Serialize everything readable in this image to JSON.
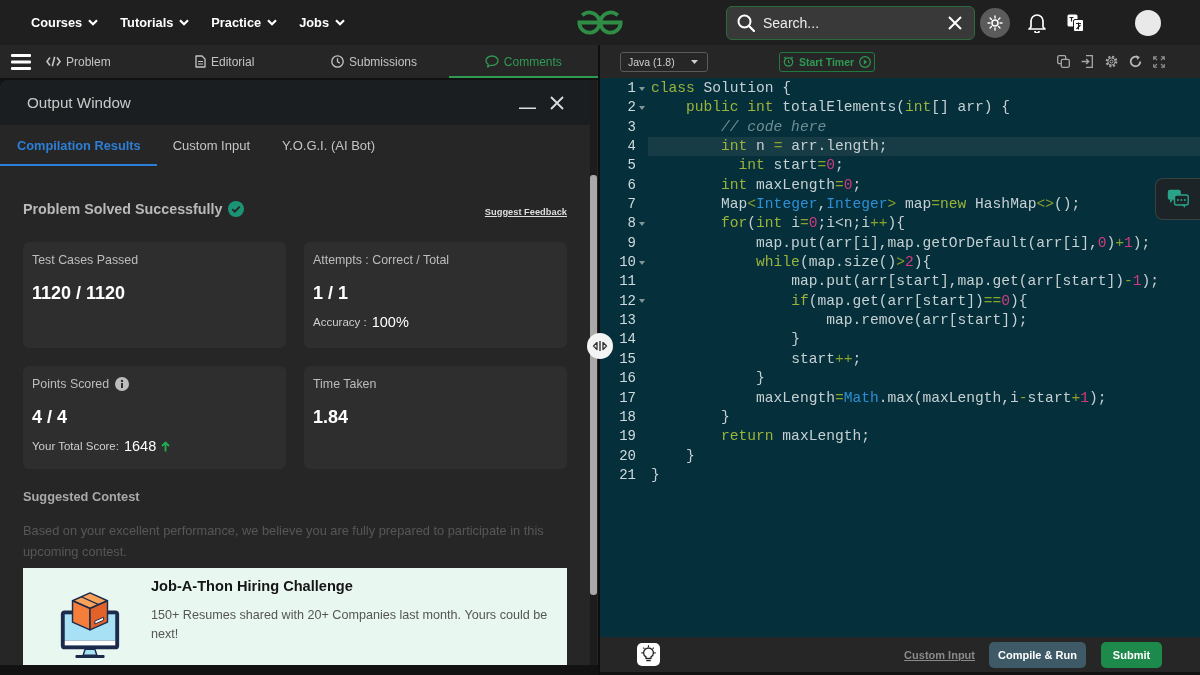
{
  "top_nav": {
    "menus": [
      {
        "label": "Courses"
      },
      {
        "label": "Tutorials"
      },
      {
        "label": "Practice"
      },
      {
        "label": "Jobs"
      }
    ],
    "search": {
      "placeholder": "Search..."
    }
  },
  "problem_tabs": [
    {
      "label": "Problem",
      "selected": false
    },
    {
      "label": "Editorial",
      "selected": false
    },
    {
      "label": "Submissions",
      "selected": false
    },
    {
      "label": "Comments",
      "selected": true
    }
  ],
  "output_window": {
    "title": "Output Window",
    "tabs": [
      {
        "label": "Compilation Results",
        "selected": true
      },
      {
        "label": "Custom Input",
        "selected": false
      },
      {
        "label": "Y.O.G.I. (AI Bot)",
        "selected": false
      }
    ],
    "result": {
      "heading": "Problem Solved Successfully",
      "solved": true,
      "feedback_link": "Suggest Feedback"
    },
    "stats": [
      {
        "label": "Test Cases Passed",
        "info": false,
        "value": "1120 / 1120"
      },
      {
        "label": "Attempts : Correct / Total",
        "info": false,
        "value": "1 / 1",
        "detail": {
          "label": "Accuracy :",
          "value": "100%",
          "rising": false
        }
      },
      {
        "label": "Points Scored",
        "info": true,
        "value": "4 / 4",
        "detail": {
          "label": "Your Total Score:",
          "value": "1648",
          "rising": true
        }
      },
      {
        "label": "Time Taken",
        "info": false,
        "value": "1.84"
      }
    ],
    "suggested_contest": {
      "heading": "Suggested Contest",
      "description": "Based on your excellent performance, we believe you are fully prepared to participate in this upcoming contest.",
      "card": {
        "title": "Job-A-Thon Hiring Challenge",
        "text": "150+ Resumes shared with 20+ Companies last month. Yours could be next!"
      }
    }
  },
  "editor": {
    "language": "Java (1.8)",
    "timer_button": "Start Timer",
    "lines": [
      {
        "number": "1",
        "foldable": true,
        "active": false,
        "tokens": [
          {
            "kind": "keyword",
            "text": "class"
          },
          {
            "kind": "plain",
            "text": " Solution {"
          }
        ]
      },
      {
        "number": "2",
        "foldable": true,
        "active": false,
        "tokens": [
          {
            "kind": "keyword",
            "text": "    public int"
          },
          {
            "kind": "plain",
            "text": " totalElements("
          },
          {
            "kind": "keyword",
            "text": "int"
          },
          {
            "kind": "plain",
            "text": "[] arr) {"
          }
        ]
      },
      {
        "number": "3",
        "foldable": false,
        "active": false,
        "tokens": [
          {
            "kind": "comment",
            "text": "        // code here"
          }
        ]
      },
      {
        "number": "4",
        "foldable": false,
        "active": true,
        "tokens": [
          {
            "kind": "keyword",
            "text": "        int"
          },
          {
            "kind": "plain",
            "text": " n "
          },
          {
            "kind": "operator",
            "text": "="
          },
          {
            "kind": "plain",
            "text": " arr.length;"
          }
        ]
      },
      {
        "number": "5",
        "foldable": false,
        "active": false,
        "tokens": [
          {
            "kind": "keyword",
            "text": "          int"
          },
          {
            "kind": "plain",
            "text": " start"
          },
          {
            "kind": "operator",
            "text": "="
          },
          {
            "kind": "number",
            "text": "0"
          },
          {
            "kind": "plain",
            "text": ";"
          }
        ]
      },
      {
        "number": "6",
        "foldable": false,
        "active": false,
        "tokens": [
          {
            "kind": "keyword",
            "text": "        int"
          },
          {
            "kind": "plain",
            "text": " maxLength"
          },
          {
            "kind": "operator",
            "text": "="
          },
          {
            "kind": "number",
            "text": "0"
          },
          {
            "kind": "plain",
            "text": ";"
          }
        ]
      },
      {
        "number": "7",
        "foldable": false,
        "active": false,
        "tokens": [
          {
            "kind": "plain",
            "text": "        Map"
          },
          {
            "kind": "operator",
            "text": "<"
          },
          {
            "kind": "type",
            "text": "Integer"
          },
          {
            "kind": "plain",
            "text": ","
          },
          {
            "kind": "type",
            "text": "Integer"
          },
          {
            "kind": "operator",
            "text": ">"
          },
          {
            "kind": "plain",
            "text": " map"
          },
          {
            "kind": "operator",
            "text": "="
          },
          {
            "kind": "keyword",
            "text": "new"
          },
          {
            "kind": "plain",
            "text": " HashMap"
          },
          {
            "kind": "operator",
            "text": "<>"
          },
          {
            "kind": "plain",
            "text": "();"
          }
        ]
      },
      {
        "number": "8",
        "foldable": true,
        "active": false,
        "tokens": [
          {
            "kind": "keyword",
            "text": "        for"
          },
          {
            "kind": "plain",
            "text": "("
          },
          {
            "kind": "keyword",
            "text": "int"
          },
          {
            "kind": "plain",
            "text": " i"
          },
          {
            "kind": "operator",
            "text": "="
          },
          {
            "kind": "number",
            "text": "0"
          },
          {
            "kind": "plain",
            "text": ";i<n;i"
          },
          {
            "kind": "operator",
            "text": "++"
          },
          {
            "kind": "plain",
            "text": "){"
          }
        ]
      },
      {
        "number": "9",
        "foldable": false,
        "active": false,
        "tokens": [
          {
            "kind": "plain",
            "text": "            map.put(arr[i],map.getOrDefault(arr[i],"
          },
          {
            "kind": "number",
            "text": "0"
          },
          {
            "kind": "plain",
            "text": ")"
          },
          {
            "kind": "operator",
            "text": "+"
          },
          {
            "kind": "number",
            "text": "1"
          },
          {
            "kind": "plain",
            "text": ");"
          }
        ]
      },
      {
        "number": "10",
        "foldable": true,
        "active": false,
        "tokens": [
          {
            "kind": "keyword",
            "text": "            while"
          },
          {
            "kind": "plain",
            "text": "(map.size()"
          },
          {
            "kind": "operator",
            "text": ">"
          },
          {
            "kind": "number",
            "text": "2"
          },
          {
            "kind": "plain",
            "text": "){"
          }
        ]
      },
      {
        "number": "11",
        "foldable": false,
        "active": false,
        "tokens": [
          {
            "kind": "plain",
            "text": "                map.put(arr[start],map.get(arr[start])"
          },
          {
            "kind": "operator",
            "text": "-"
          },
          {
            "kind": "number",
            "text": "1"
          },
          {
            "kind": "plain",
            "text": ");"
          }
        ]
      },
      {
        "number": "12",
        "foldable": true,
        "active": false,
        "tokens": [
          {
            "kind": "keyword",
            "text": "                if"
          },
          {
            "kind": "plain",
            "text": "(map.get(arr[start])"
          },
          {
            "kind": "operator",
            "text": "=="
          },
          {
            "kind": "number",
            "text": "0"
          },
          {
            "kind": "plain",
            "text": "){"
          }
        ]
      },
      {
        "number": "13",
        "foldable": false,
        "active": false,
        "tokens": [
          {
            "kind": "plain",
            "text": "                    map.remove(arr[start]);"
          }
        ]
      },
      {
        "number": "14",
        "foldable": false,
        "active": false,
        "tokens": [
          {
            "kind": "plain",
            "text": "                }"
          }
        ]
      },
      {
        "number": "15",
        "foldable": false,
        "active": false,
        "tokens": [
          {
            "kind": "plain",
            "text": "                start"
          },
          {
            "kind": "operator",
            "text": "++"
          },
          {
            "kind": "plain",
            "text": ";"
          }
        ]
      },
      {
        "number": "16",
        "foldable": false,
        "active": false,
        "tokens": [
          {
            "kind": "plain",
            "text": "            }"
          }
        ]
      },
      {
        "number": "17",
        "foldable": false,
        "active": false,
        "tokens": [
          {
            "kind": "plain",
            "text": "            maxLength"
          },
          {
            "kind": "operator",
            "text": "="
          },
          {
            "kind": "type",
            "text": "Math"
          },
          {
            "kind": "plain",
            "text": ".max(maxLength,i"
          },
          {
            "kind": "operator",
            "text": "-"
          },
          {
            "kind": "plain",
            "text": "start"
          },
          {
            "kind": "operator",
            "text": "+"
          },
          {
            "kind": "number",
            "text": "1"
          },
          {
            "kind": "plain",
            "text": ");"
          }
        ]
      },
      {
        "number": "18",
        "foldable": false,
        "active": false,
        "tokens": [
          {
            "kind": "plain",
            "text": "        }"
          }
        ]
      },
      {
        "number": "19",
        "foldable": false,
        "active": false,
        "tokens": [
          {
            "kind": "keyword",
            "text": "        return"
          },
          {
            "kind": "plain",
            "text": " maxLength;"
          }
        ]
      },
      {
        "number": "20",
        "foldable": false,
        "active": false,
        "tokens": [
          {
            "kind": "plain",
            "text": "    }"
          }
        ]
      },
      {
        "number": "21",
        "foldable": false,
        "active": false,
        "tokens": [
          {
            "kind": "plain",
            "text": "}"
          }
        ]
      }
    ],
    "footer": {
      "link": "Custom Input",
      "buttons": [
        {
          "label": "Compile & Run",
          "kind": "secondary"
        },
        {
          "label": "Submit",
          "kind": "primary"
        }
      ]
    }
  }
}
